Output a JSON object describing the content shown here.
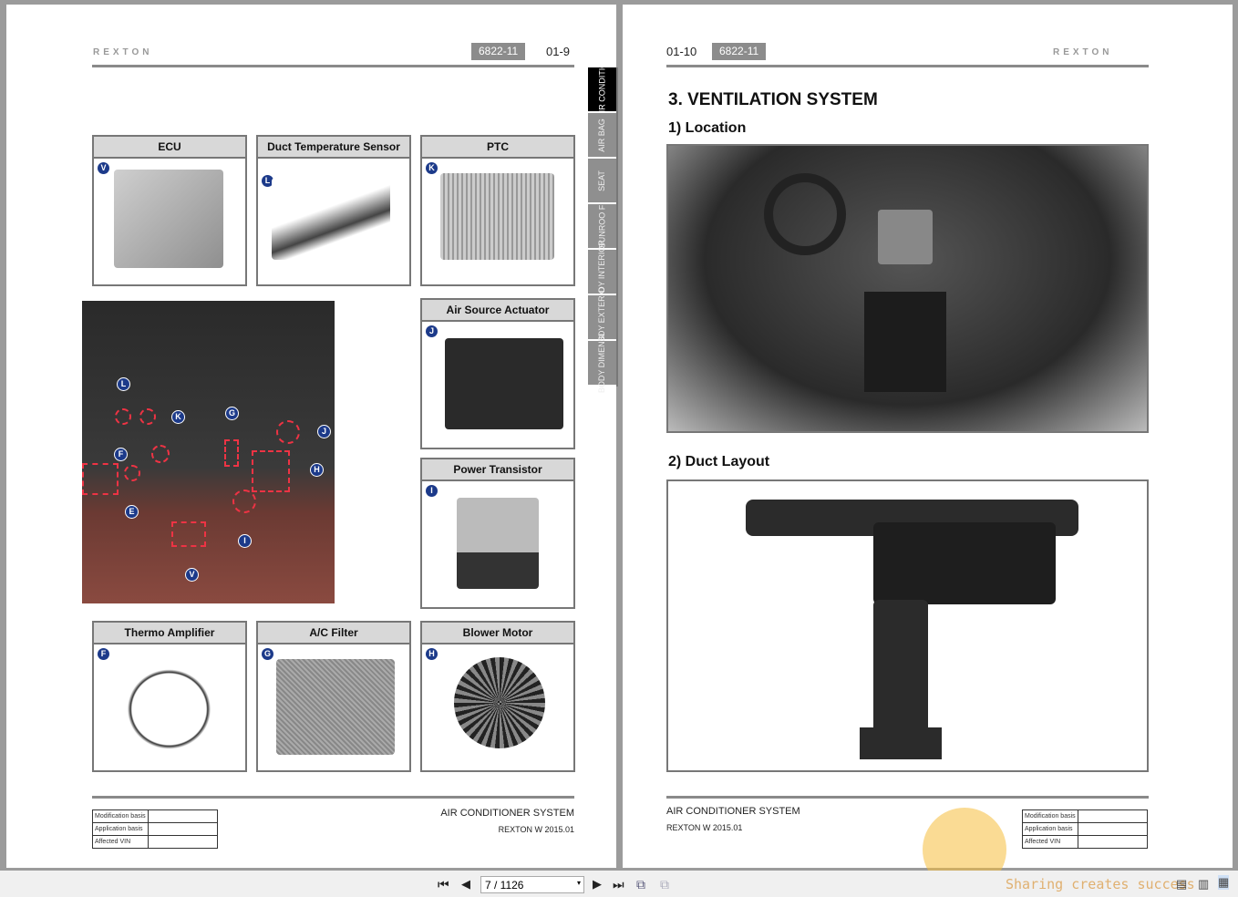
{
  "left_page": {
    "logo": "REXTON",
    "doc_code": "6822-11",
    "page_number": "01-9",
    "side_tabs": [
      "AIR CONDITIO",
      "AIR BAG",
      "SEAT",
      "SUNROO F",
      "BODY INTERIOR",
      "BODY EXTERIO",
      "BODY DIMENSI"
    ],
    "components": [
      {
        "title": "ECU",
        "letter": "V"
      },
      {
        "title": "Duct Temperature Sensor",
        "letter": "L"
      },
      {
        "title": "PTC",
        "letter": "K"
      },
      {
        "title": "Air Source Actuator",
        "letter": "J"
      },
      {
        "title": "Power Transistor",
        "letter": "I"
      },
      {
        "title": "Thermo Amplifier",
        "letter": "F"
      },
      {
        "title": "A/C Filter",
        "letter": "G"
      },
      {
        "title": "Blower Motor",
        "letter": "H"
      }
    ],
    "callouts": [
      "L",
      "K",
      "G",
      "J",
      "F",
      "H",
      "E",
      "I",
      "V"
    ],
    "footer": {
      "system": "AIR CONDITIONER SYSTEM",
      "model": "REXTON W 2015.01",
      "table": [
        "Modification basis",
        "Application basis",
        "Affected VIN"
      ]
    }
  },
  "right_page": {
    "page_number": "01-10",
    "doc_code": "6822-11",
    "logo": "REXTON",
    "title": "3. VENTILATION SYSTEM",
    "section1": "1) Location",
    "section2": "2) Duct Layout",
    "footer": {
      "system": "AIR CONDITIONER SYSTEM",
      "model": "REXTON W 2015.01",
      "table": [
        "Modification basis",
        "Application basis",
        "Affected VIN"
      ]
    }
  },
  "toolbar": {
    "page_field": "7 / 1126",
    "watermark": "Sharing creates success"
  }
}
